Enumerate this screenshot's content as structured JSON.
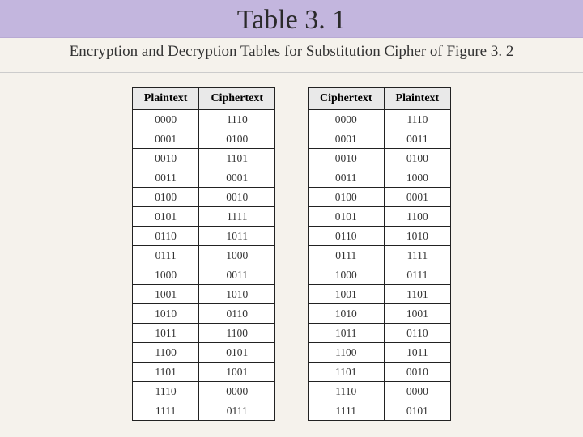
{
  "title": "Table 3. 1",
  "subtitle": "Encryption and Decryption Tables for Substitution Cipher of Figure 3. 2",
  "left_table": {
    "headers": [
      "Plaintext",
      "Ciphertext"
    ],
    "rows": [
      [
        "0000",
        "1110"
      ],
      [
        "0001",
        "0100"
      ],
      [
        "0010",
        "1101"
      ],
      [
        "0011",
        "0001"
      ],
      [
        "0100",
        "0010"
      ],
      [
        "0101",
        "1111"
      ],
      [
        "0110",
        "1011"
      ],
      [
        "0111",
        "1000"
      ],
      [
        "1000",
        "0011"
      ],
      [
        "1001",
        "1010"
      ],
      [
        "1010",
        "0110"
      ],
      [
        "1011",
        "1100"
      ],
      [
        "1100",
        "0101"
      ],
      [
        "1101",
        "1001"
      ],
      [
        "1110",
        "0000"
      ],
      [
        "1111",
        "0111"
      ]
    ]
  },
  "right_table": {
    "headers": [
      "Ciphertext",
      "Plaintext"
    ],
    "rows": [
      [
        "0000",
        "1110"
      ],
      [
        "0001",
        "0011"
      ],
      [
        "0010",
        "0100"
      ],
      [
        "0011",
        "1000"
      ],
      [
        "0100",
        "0001"
      ],
      [
        "0101",
        "1100"
      ],
      [
        "0110",
        "1010"
      ],
      [
        "0111",
        "1111"
      ],
      [
        "1000",
        "0111"
      ],
      [
        "1001",
        "1101"
      ],
      [
        "1010",
        "1001"
      ],
      [
        "1011",
        "0110"
      ],
      [
        "1100",
        "1011"
      ],
      [
        "1101",
        "0010"
      ],
      [
        "1110",
        "0000"
      ],
      [
        "1111",
        "0101"
      ]
    ]
  },
  "chart_data": [
    {
      "type": "table",
      "title": "Encryption Table",
      "columns": [
        "Plaintext",
        "Ciphertext"
      ],
      "rows": [
        [
          "0000",
          "1110"
        ],
        [
          "0001",
          "0100"
        ],
        [
          "0010",
          "1101"
        ],
        [
          "0011",
          "0001"
        ],
        [
          "0100",
          "0010"
        ],
        [
          "0101",
          "1111"
        ],
        [
          "0110",
          "1011"
        ],
        [
          "0111",
          "1000"
        ],
        [
          "1000",
          "0011"
        ],
        [
          "1001",
          "1010"
        ],
        [
          "1010",
          "0110"
        ],
        [
          "1011",
          "1100"
        ],
        [
          "1100",
          "0101"
        ],
        [
          "1101",
          "1001"
        ],
        [
          "1110",
          "0000"
        ],
        [
          "1111",
          "0111"
        ]
      ]
    },
    {
      "type": "table",
      "title": "Decryption Table",
      "columns": [
        "Ciphertext",
        "Plaintext"
      ],
      "rows": [
        [
          "0000",
          "1110"
        ],
        [
          "0001",
          "0011"
        ],
        [
          "0010",
          "0100"
        ],
        [
          "0011",
          "1000"
        ],
        [
          "0100",
          "0001"
        ],
        [
          "0101",
          "1100"
        ],
        [
          "0110",
          "1010"
        ],
        [
          "0111",
          "1111"
        ],
        [
          "1000",
          "0111"
        ],
        [
          "1001",
          "1101"
        ],
        [
          "1010",
          "1001"
        ],
        [
          "1011",
          "0110"
        ],
        [
          "1100",
          "1011"
        ],
        [
          "1101",
          "0010"
        ],
        [
          "1110",
          "0000"
        ],
        [
          "1111",
          "0101"
        ]
      ]
    }
  ]
}
